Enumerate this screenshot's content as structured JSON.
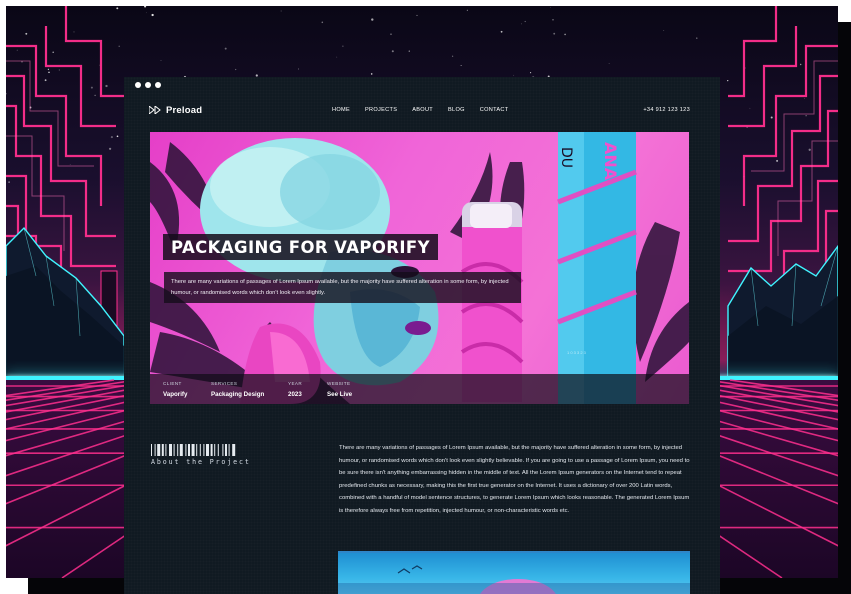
{
  "window": {
    "dots": 3
  },
  "nav": {
    "logo": "Preload",
    "links": [
      "HOME",
      "PROJECTS",
      "ABOUT",
      "BLOG",
      "CONTACT"
    ],
    "phone": "+34 912 123 123"
  },
  "hero": {
    "title": "PACKAGING FOR VAPORIFY",
    "description": "There are many variations of passages of Lorem Ipsum available, but the majority have suffered alteration in some form, by injected humour, or randomised words which don't look even slightly."
  },
  "meta": [
    {
      "key": "CLIENT",
      "value": "Vaporify"
    },
    {
      "key": "SERVICES",
      "value": "Packaging Design"
    },
    {
      "key": "YEAR",
      "value": "2023"
    },
    {
      "key": "WEBSITE",
      "value": "See Live"
    }
  ],
  "about": {
    "label": "About the Project",
    "body": "There are many variations of passages of Lorem Ipsum available, but the majority have suffered alteration in some form, by injected humour, or randomised words which don't look even slightly believable. If you are going to use a passage of Lorem Ipsum, you need to be sure there isn't anything embarrassing hidden in the middle of text. All the Lorem Ipsum generators on the Internet tend to repeat predefined chunks as necessary, making this the first true generator on the Internet. It uses a dictionary of over 200 Latin words, combined with a handful of model sentence structures, to generate Lorem Ipsum which looks reasonable. The generated Lorem Ipsum is therefore always free from repetition, injected humour, or non-characteristic words etc."
  },
  "colors": {
    "window_bg": "#101a22",
    "hero_pink": "#f065d8",
    "neon_cyan": "#3ff4ff",
    "neon_pink": "#ff2f8e"
  },
  "icons": {
    "logo": "play-forward-icon",
    "barcode": "barcode-icon"
  }
}
